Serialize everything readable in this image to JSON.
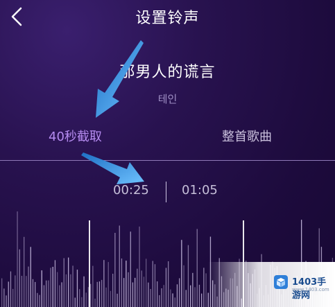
{
  "header": {
    "title": "设置铃声",
    "back_icon": "chevron-left-icon"
  },
  "song": {
    "title": "那男人的谎言",
    "artist": "테인"
  },
  "tabs": [
    {
      "label": "40秒截取",
      "active": true
    },
    {
      "label": "整首歌曲",
      "active": false
    }
  ],
  "selection": {
    "start": "00:25",
    "end": "01:05"
  },
  "watermark": {
    "text": "1403手游网",
    "sub": "www.1403.com"
  },
  "colors": {
    "accent": "#b58bf0",
    "arrow": "#4aa3e8"
  }
}
